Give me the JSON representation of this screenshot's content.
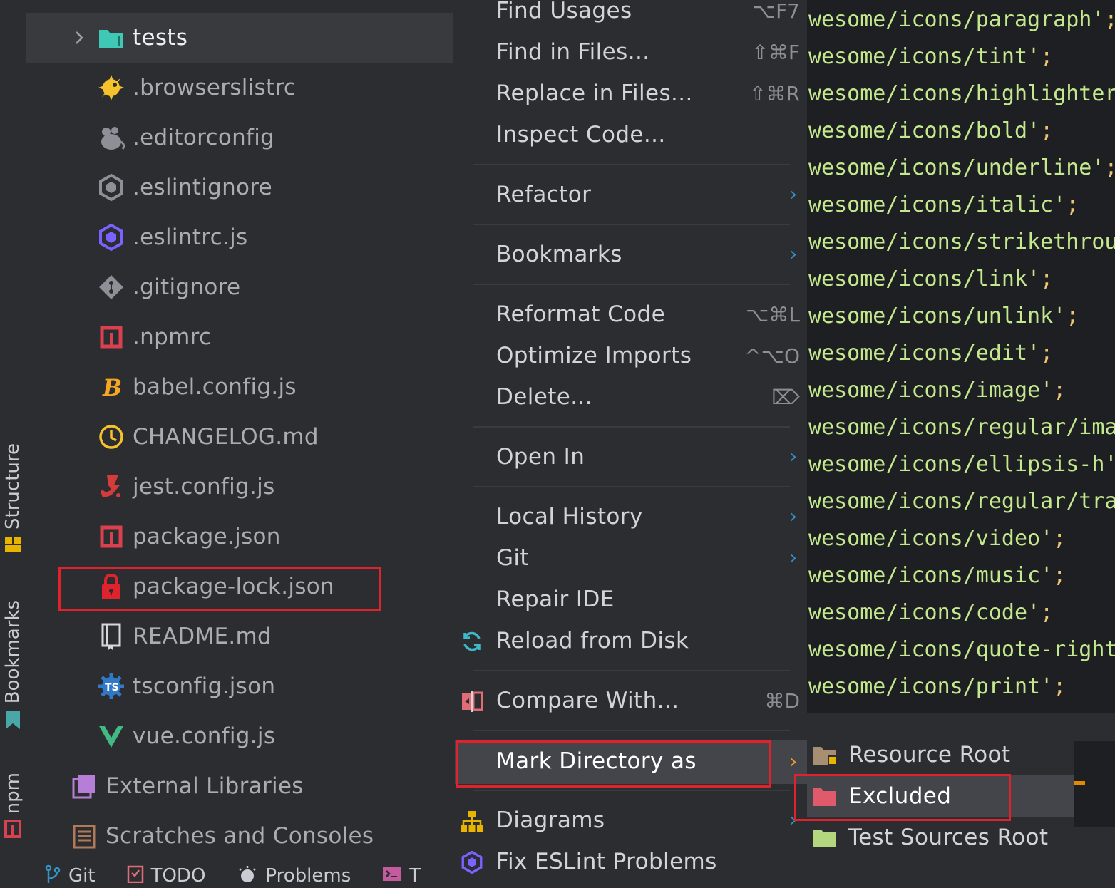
{
  "project_tree": {
    "items": [
      {
        "name": "tests",
        "icon": "test-folder-icon",
        "kind": "folder",
        "expanded": false,
        "selected": true
      },
      {
        "name": ".browserslistrc",
        "icon": "browserslist-icon"
      },
      {
        "name": ".editorconfig",
        "icon": "editorconfig-icon"
      },
      {
        "name": ".eslintignore",
        "icon": "eslint-ignore-icon"
      },
      {
        "name": ".eslintrc.js",
        "icon": "eslint-icon"
      },
      {
        "name": ".gitignore",
        "icon": "git-icon"
      },
      {
        "name": ".npmrc",
        "icon": "npm-icon"
      },
      {
        "name": "babel.config.js",
        "icon": "babel-icon"
      },
      {
        "name": "CHANGELOG.md",
        "icon": "changelog-icon"
      },
      {
        "name": "jest.config.js",
        "icon": "jest-icon"
      },
      {
        "name": "package.json",
        "icon": "npm-icon"
      },
      {
        "name": "package-lock.json",
        "icon": "lock-icon",
        "highlighted": true
      },
      {
        "name": "README.md",
        "icon": "readme-icon"
      },
      {
        "name": "tsconfig.json",
        "icon": "tsconfig-icon"
      },
      {
        "name": "vue.config.js",
        "icon": "vue-icon"
      }
    ],
    "external_libraries": "External Libraries",
    "scratches": "Scratches and Consoles"
  },
  "side_tabs": {
    "structure": "Structure",
    "bookmarks": "Bookmarks",
    "npm": "npm"
  },
  "bottom_tabs": {
    "git": "Git",
    "todo": "TODO",
    "problems": "Problems",
    "terminal": "T"
  },
  "context_menu": {
    "items": [
      {
        "label": "Find Usages",
        "shortcut": "⌥F7"
      },
      {
        "label": "Find in Files...",
        "shortcut": "⇧⌘F"
      },
      {
        "label": "Replace in Files...",
        "shortcut": "⇧⌘R"
      },
      {
        "label": "Inspect Code..."
      },
      {
        "label": "Refactor",
        "submenu": true
      },
      {
        "label": "Bookmarks",
        "submenu": true
      },
      {
        "label": "Reformat Code",
        "shortcut": "⌥⌘L"
      },
      {
        "label": "Optimize Imports",
        "shortcut": "^⌥O"
      },
      {
        "label": "Delete...",
        "shortcut": "⌦"
      },
      {
        "label": "Open In",
        "submenu": true
      },
      {
        "label": "Local History",
        "submenu": true
      },
      {
        "label": "Git",
        "submenu": true
      },
      {
        "label": "Repair IDE"
      },
      {
        "label": "Reload from Disk",
        "icon": "reload-icon"
      },
      {
        "label": "Compare With...",
        "shortcut": "⌘D",
        "icon": "compare-icon"
      },
      {
        "label": "Mark Directory as",
        "submenu": true,
        "active": true
      },
      {
        "label": "Diagrams",
        "submenu": true,
        "icon": "diagram-icon"
      },
      {
        "label": "Fix ESLint Problems",
        "icon": "eslint-icon"
      }
    ],
    "submenu_arrow": "›"
  },
  "mark_directory_submenu": {
    "items": [
      {
        "label": "Resource Root",
        "icon": "resource-root-folder-icon",
        "color": "#a88f74"
      },
      {
        "label": "Excluded",
        "icon": "excluded-folder-icon",
        "color": "#e05a6b",
        "active": true
      },
      {
        "label": "Test Sources Root",
        "icon": "test-sources-folder-icon",
        "color": "#b4d67e"
      }
    ]
  },
  "editor": {
    "lines": [
      {
        "text": "wesome/icons/paragraph'",
        "semi": ";"
      },
      {
        "text": "wesome/icons/tint'",
        "semi": ";"
      },
      {
        "text": "wesome/icons/highlighter",
        "semi": ""
      },
      {
        "text": "wesome/icons/bold'",
        "semi": ";"
      },
      {
        "text": "wesome/icons/underline'",
        "semi": ";"
      },
      {
        "text": "wesome/icons/italic'",
        "semi": ";"
      },
      {
        "text": "wesome/icons/strikethrou",
        "semi": ""
      },
      {
        "text": "wesome/icons/link'",
        "semi": ";"
      },
      {
        "text": "wesome/icons/unlink'",
        "semi": ";"
      },
      {
        "text": "wesome/icons/edit'",
        "semi": ";"
      },
      {
        "text": "wesome/icons/image'",
        "semi": ";"
      },
      {
        "text": "wesome/icons/regular/ima",
        "semi": ""
      },
      {
        "text": "wesome/icons/ellipsis-h'",
        "semi": ""
      },
      {
        "text": "wesome/icons/regular/tra",
        "semi": ""
      },
      {
        "text": "wesome/icons/video'",
        "semi": ";"
      },
      {
        "text": "wesome/icons/music'",
        "semi": ";"
      },
      {
        "text": "wesome/icons/code'",
        "semi": ";"
      },
      {
        "text": "wesome/icons/quote-right",
        "semi": ""
      },
      {
        "text": "wesome/icons/print'",
        "semi": ";"
      }
    ]
  },
  "colors": {
    "background": "#2b2d30",
    "editor_background": "#1e1f22",
    "highlight_border": "#e0222d",
    "menu_active": "#43454a",
    "string": "#c3e88d",
    "punctuation": "#f0c674",
    "arrow": "#3592c4"
  }
}
